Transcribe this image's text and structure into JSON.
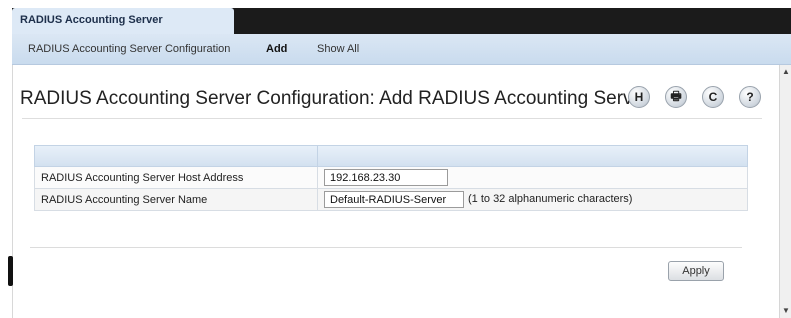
{
  "tab": {
    "label": "RADIUS Accounting Server Configuration"
  },
  "subnav": {
    "items": [
      {
        "label": "RADIUS Accounting Server Configuration"
      },
      {
        "label": "Add"
      },
      {
        "label": "Show All"
      }
    ]
  },
  "page": {
    "title": "RADIUS Accounting Server Configuration: Add RADIUS Accounting Server"
  },
  "toolbar_icons": [
    {
      "name": "save-icon",
      "glyph": "H"
    },
    {
      "name": "print-icon",
      "glyph": "🖶"
    },
    {
      "name": "refresh-icon",
      "glyph": "C"
    },
    {
      "name": "help-icon",
      "glyph": "?"
    }
  ],
  "form": {
    "host_address": {
      "label": "RADIUS Accounting Server Host Address",
      "value": "192.168.23.30"
    },
    "server_name": {
      "label": "RADIUS Accounting Server Name",
      "value": "Default-RADIUS-Server",
      "hint": "(1 to 32 alphanumeric characters)"
    }
  },
  "actions": {
    "apply_label": "Apply"
  },
  "colors": {
    "topbar": "#1b1b1b",
    "nav_bg": "#dde9f6",
    "header_bg": "#d3e1f0"
  }
}
